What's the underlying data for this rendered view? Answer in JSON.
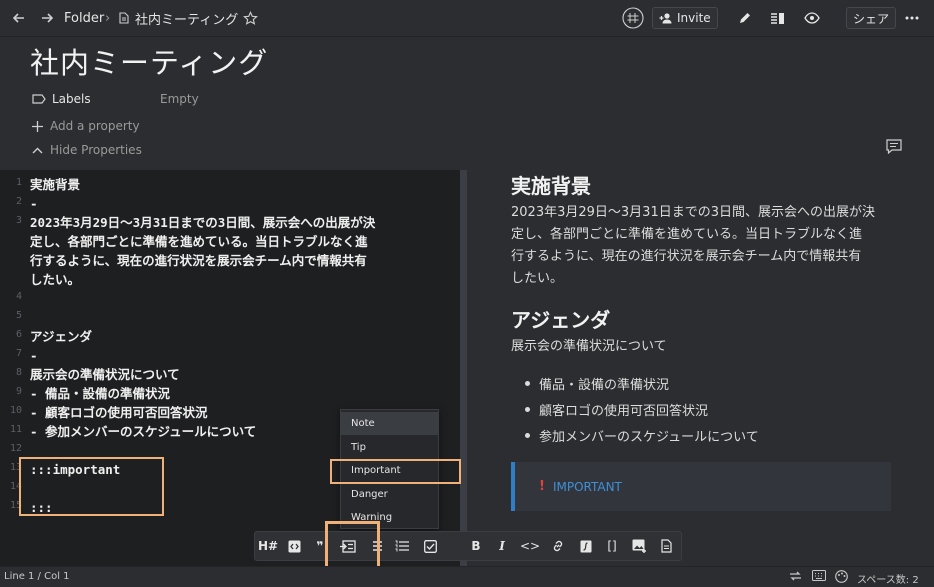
{
  "topbar": {
    "breadcrumb_folder": "Folder",
    "breadcrumb_sep": "›",
    "doc_title": "社内ミーティング",
    "invite_label": "Invite",
    "share_label": "シェア"
  },
  "doc": {
    "title": "社内ミーティング",
    "labels_label": "Labels",
    "labels_value": "Empty",
    "add_property": "Add a property",
    "hide_properties": "Hide Properties"
  },
  "editor": {
    "lines": [
      {
        "n": "1",
        "text": "実施背景"
      },
      {
        "n": "2",
        "text": "-"
      },
      {
        "n": "3",
        "text": "2023年3月29日～3月31日までの3日間、展示会への出展が決"
      },
      {
        "n": "",
        "text": "定し、各部門ごとに準備を進めている。当日トラブルなく進"
      },
      {
        "n": "",
        "text": "行するように、現在の進行状況を展示会チーム内で情報共有"
      },
      {
        "n": "",
        "text": "したい。"
      },
      {
        "n": "4",
        "text": ""
      },
      {
        "n": "5",
        "text": ""
      },
      {
        "n": "6",
        "text": "アジェンダ"
      },
      {
        "n": "7",
        "text": "-"
      },
      {
        "n": "8",
        "text": "展示会の準備状況について"
      },
      {
        "n": "9",
        "text": "- 備品・設備の準備状況"
      },
      {
        "n": "10",
        "text": "- 顧客ロゴの使用可否回答状況"
      },
      {
        "n": "11",
        "text": "- 参加メンバーのスケジュールについて"
      },
      {
        "n": "12",
        "text": ""
      },
      {
        "n": "13",
        "text": ":::important"
      },
      {
        "n": "14",
        "text": ""
      },
      {
        "n": "15",
        "text": ":::"
      }
    ]
  },
  "preview": {
    "h1": "実施背景",
    "p1": [
      "2023年3月29日～3月31日までの3日間、展示会への出展が決",
      "定し、各部門ごとに準備を進めている。当日トラブルなく進",
      "行するように、現在の進行状況を展示会チーム内で情報共有",
      "したい。"
    ],
    "h2": "アジェンダ",
    "p2": "展示会の準備状況について",
    "items": [
      "備品・設備の準備状況",
      "顧客ロゴの使用可否回答状況",
      "参加メンバーのスケジュールについて"
    ],
    "callout_mark": "!",
    "callout_label": "IMPORTANT"
  },
  "menu": {
    "items": [
      "Note",
      "Tip",
      "Important",
      "Danger",
      "Warning"
    ],
    "active": "Important"
  },
  "toolbar": {
    "heading": "H#",
    "quote": "❞",
    "bold": "B",
    "italic": "I",
    "code": "<>",
    "brackets": "[]"
  },
  "status": {
    "position": "Line 1 / Col 1",
    "spaces": "スペース数: 2"
  },
  "colors": {
    "accent": "#2f7fc8",
    "highlight": "#f0b07a",
    "callout_icon": "#e0413a"
  }
}
